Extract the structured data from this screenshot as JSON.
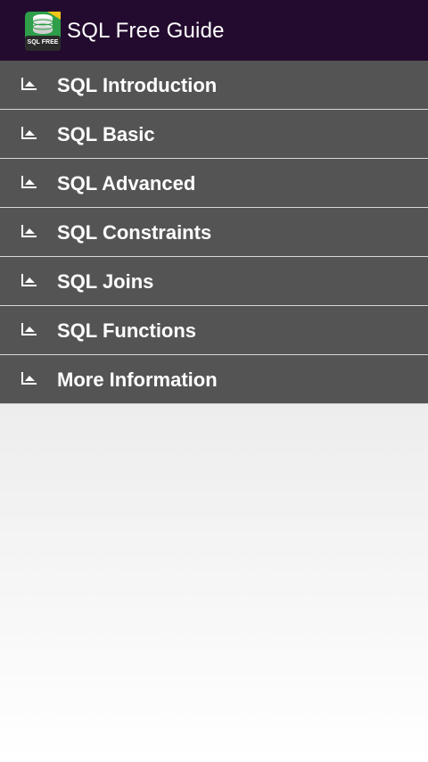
{
  "app": {
    "title": "SQL Free Guide",
    "icon": "sql-database-app-icon",
    "icon_text": "SQL FREE"
  },
  "colors": {
    "action_bar": "#230b2f",
    "menu_item_bg": "#545454",
    "menu_text": "#ffffff",
    "divider": "#d8d8d8",
    "icon_green": "#2e9e4a"
  },
  "menu": {
    "items": [
      {
        "label": "SQL Introduction",
        "icon": "chart-bullet-icon"
      },
      {
        "label": "SQL Basic",
        "icon": "chart-bullet-icon"
      },
      {
        "label": "SQL Advanced",
        "icon": "chart-bullet-icon"
      },
      {
        "label": "SQL Constraints",
        "icon": "chart-bullet-icon"
      },
      {
        "label": "SQL Joins",
        "icon": "chart-bullet-icon"
      },
      {
        "label": "SQL Functions",
        "icon": "chart-bullet-icon"
      },
      {
        "label": "More Information",
        "icon": "chart-bullet-icon"
      }
    ]
  }
}
